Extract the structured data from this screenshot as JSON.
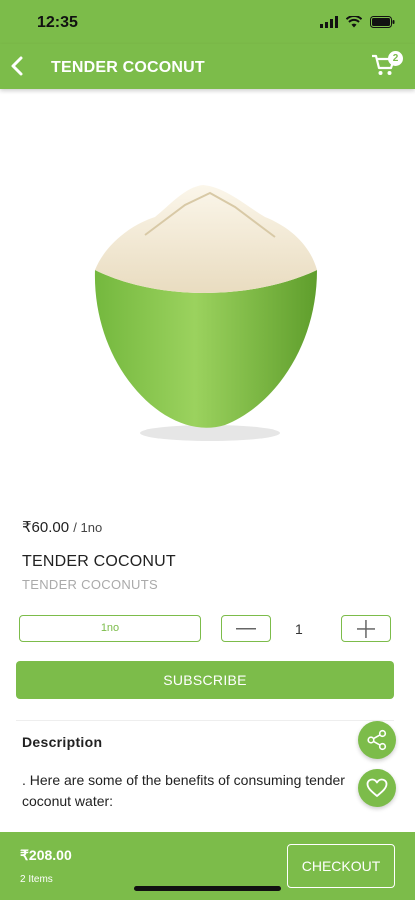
{
  "status_bar": {
    "time": "12:35"
  },
  "header": {
    "title": "TENDER COCONUT",
    "cart_count": "2"
  },
  "product": {
    "price": "₹60.00",
    "unit": "/ 1no",
    "name": "TENDER COCONUT",
    "subtitle": "TENDER COCONUTS",
    "variant": "1no",
    "quantity": "1",
    "subscribe_label": "SUBSCRIBE"
  },
  "description": {
    "title": "Description",
    "line1": ". Here are some of the benefits of consuming tender",
    "line2": "coconut water:"
  },
  "bottom_bar": {
    "total": "₹208.00",
    "items": "2 Items",
    "checkout_label": "CHECKOUT"
  },
  "colors": {
    "accent": "#7cbc4a",
    "background": "#ffffff"
  }
}
